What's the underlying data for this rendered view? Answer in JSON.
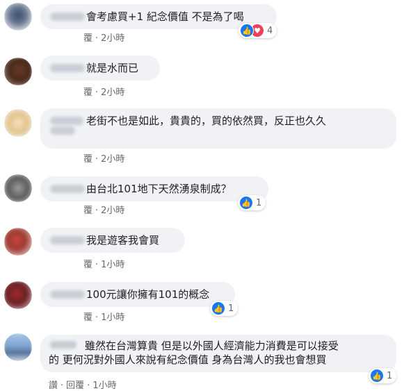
{
  "comments": [
    {
      "text": "會考慮買+1 紀念價值 不是為了喝",
      "actions_prefix": "覆",
      "time": "2小時",
      "reaction_count": "4",
      "reactions": [
        "like",
        "love"
      ]
    },
    {
      "text": "就是水而已",
      "actions_prefix": "覆",
      "time": "2小時"
    },
    {
      "text": "老街不也是如此，貴貴的，買的依然買，反正也久久",
      "actions_prefix": "覆",
      "time": "2小時"
    },
    {
      "text": "由台北101地下天然湧泉制成？",
      "actions_prefix": "覆",
      "time": "2小時",
      "reaction_count": "1",
      "reactions": [
        "like"
      ]
    },
    {
      "text": "我是遊客我會買",
      "actions_prefix": "覆",
      "time": "1小時"
    },
    {
      "text": "100元讓你擁有101的概念",
      "actions_prefix": "覆",
      "time": "1小時",
      "reaction_count": "1",
      "reactions": [
        "like"
      ]
    },
    {
      "text_line1": "雖然在台灣算貴 但是以外國人經濟能力消費是可以接受",
      "text_line2": "的 更何況對外國人來說有紀念價值 身為台灣人的我也會想買",
      "like_label": "讚",
      "reply_label": "回覆",
      "time": "1小時",
      "reaction_count": "1",
      "reactions": [
        "like"
      ]
    }
  ],
  "separator": "·",
  "colors": {
    "like": "#1877f2",
    "love": "#f33e58",
    "bubble": "#f0f2f5",
    "meta": "#65676b"
  },
  "icons": {
    "like": "thumbs-up-icon",
    "love": "heart-icon"
  }
}
